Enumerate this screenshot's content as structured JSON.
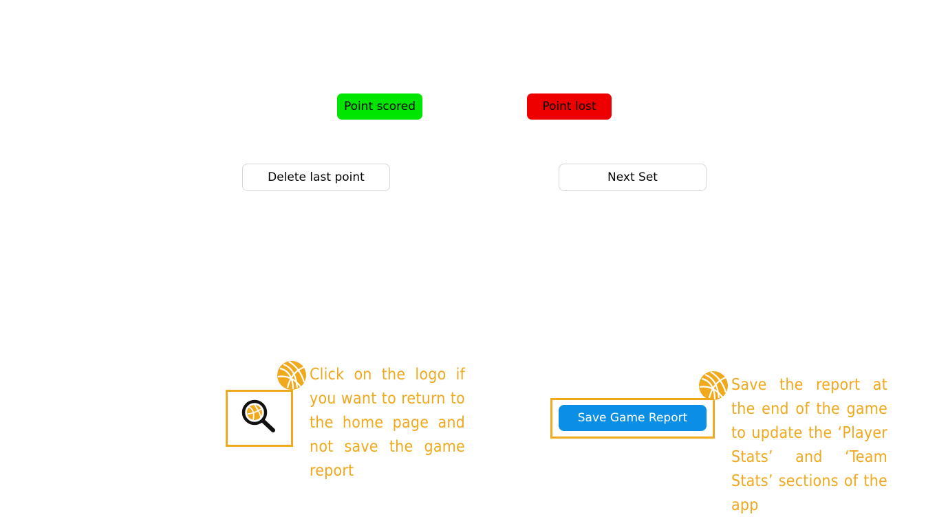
{
  "colors": {
    "point_scored_bg": "#00e600",
    "point_lost_bg": "#ee0000",
    "save_button_bg": "#0b8fe6",
    "annotation_accent": "#f0a81d",
    "outline_border": "#d6d6d6"
  },
  "scoring": {
    "point_scored_label": "Point scored",
    "point_lost_label": "Point lost"
  },
  "controls": {
    "delete_last_point_label": "Delete last point",
    "next_set_label": "Next Set"
  },
  "footer": {
    "logo_icon": "volleyball-magnifier-logo-icon",
    "save_report_label": "Save Game Report"
  },
  "annotations": {
    "marker_icon": "volleyball-icon",
    "logo_hint": "Click on the logo if you want to return to the home page and not save the game report",
    "save_hint": "Save the report at the end of the game to update the ‘Player Stats’ and ‘Team Stats’ sections of the app"
  }
}
